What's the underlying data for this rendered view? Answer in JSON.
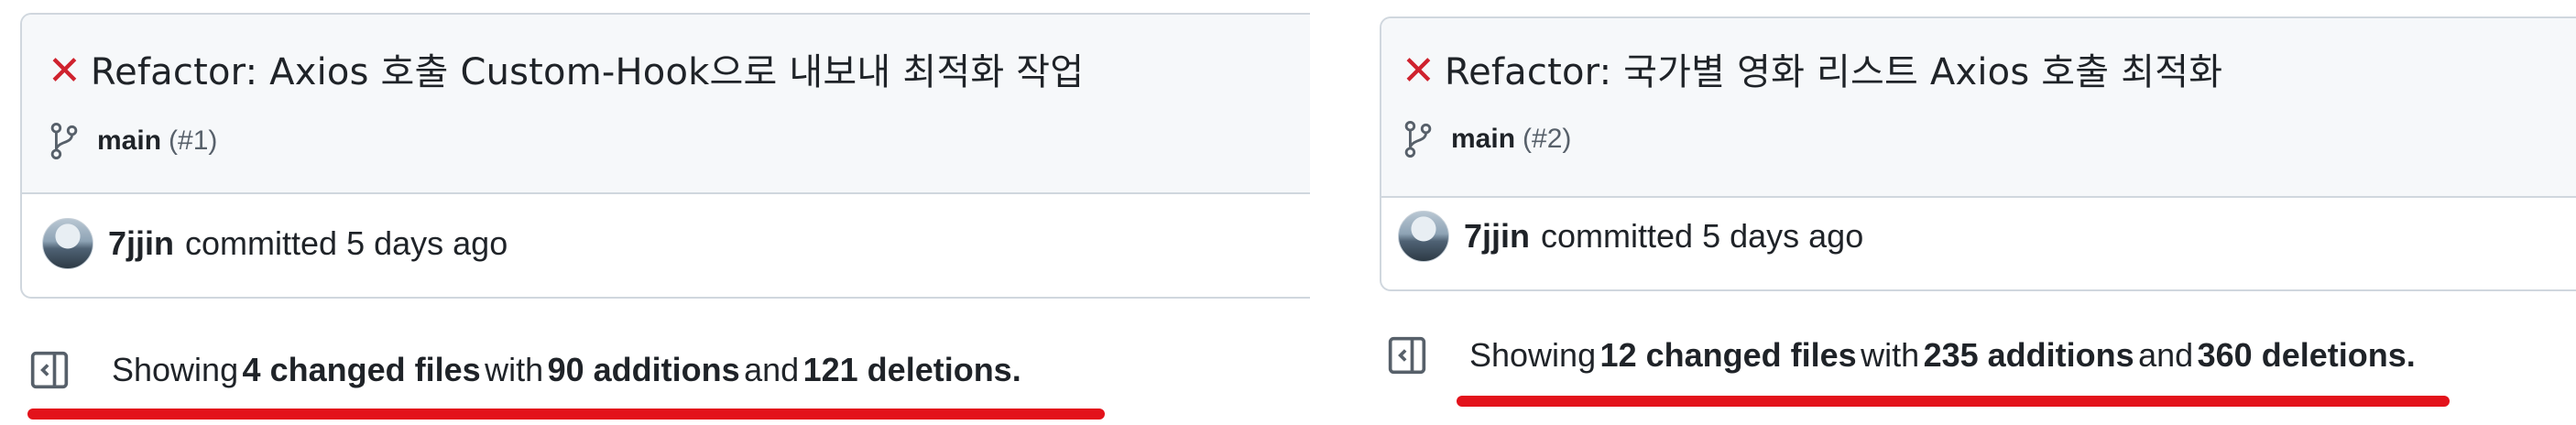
{
  "colors": {
    "fail_red": "#cf222e",
    "underline_red": "#e3121b",
    "border": "#d0d7de",
    "header_bg": "#f6f8fa",
    "muted": "#57606a"
  },
  "commits": [
    {
      "status_icon": "close-icon",
      "title": "Refactor: Axios 호출 Custom-Hook으로 내보내 최적화 작업",
      "branch_icon": "git-branch-icon",
      "branch": "main",
      "pr": "(#1)",
      "avatar_icon": "avatar",
      "author": "7jjin",
      "meta": "committed 5 days ago",
      "summary": {
        "showing": "Showing",
        "changed_files": "4 changed files",
        "with": "with",
        "additions": "90 additions",
        "and": "and",
        "deletions": "121 deletions",
        "period": "."
      }
    },
    {
      "status_icon": "close-icon",
      "title": "Refactor: 국가별 영화 리스트 Axios 호출 최적화",
      "branch_icon": "git-branch-icon",
      "branch": "main",
      "pr": "(#2)",
      "avatar_icon": "avatar",
      "author": "7jjin",
      "meta": "committed 5 days ago",
      "summary": {
        "showing": "Showing",
        "changed_files": "12 changed files",
        "with": "with",
        "additions": "235 additions",
        "and": "and",
        "deletions": "360 deletions",
        "period": "."
      }
    }
  ]
}
